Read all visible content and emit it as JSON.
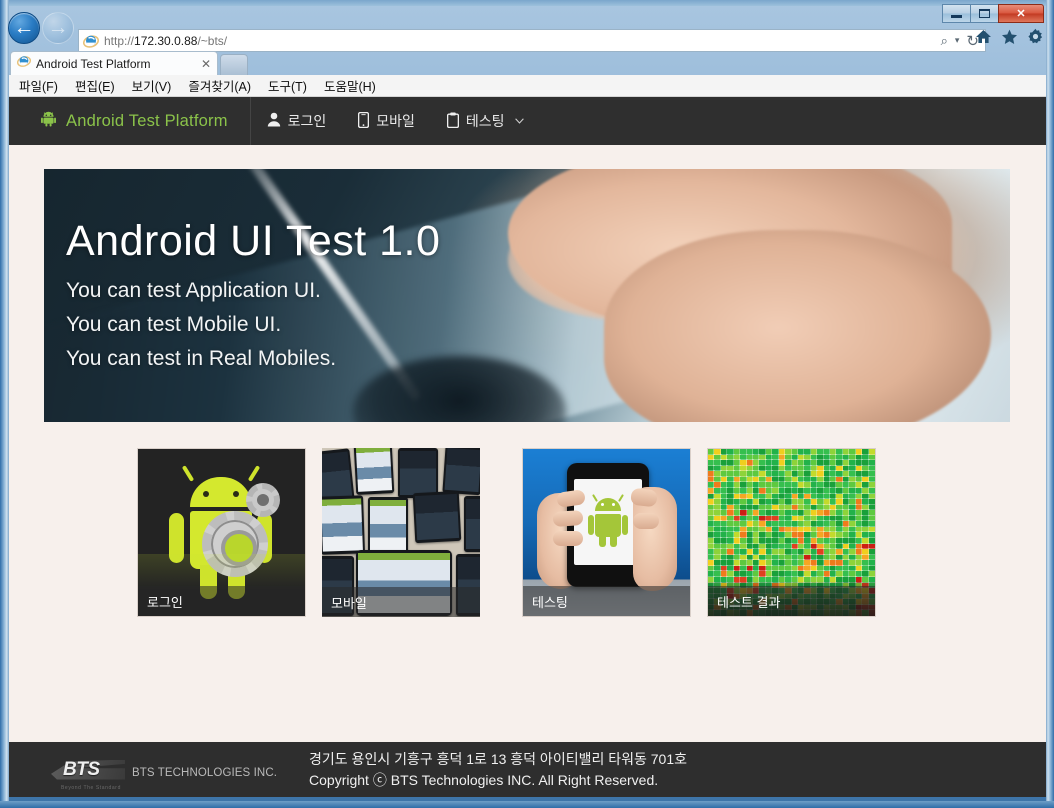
{
  "browser": {
    "window_controls": {
      "minimize": "minimize-button",
      "maximize": "maximize-button",
      "close": "✕"
    },
    "back_arrow": "←",
    "forward_arrow": "→",
    "address": {
      "scheme": "http://",
      "host": "172.30.0.88",
      "path": "/~bts/",
      "full": "http://172.30.0.88/~bts/"
    },
    "address_tools": {
      "search": "⌕",
      "dropdown": "▾",
      "refresh": "↻"
    },
    "toolbar_icons": {
      "home": "⌂",
      "favorites": "★",
      "tools": "⚙"
    },
    "tab": {
      "title": "Android Test Platform",
      "close": "✕"
    },
    "menu": [
      "파일(F)",
      "편집(E)",
      "보기(V)",
      "즐겨찾기(A)",
      "도구(T)",
      "도움말(H)"
    ]
  },
  "site": {
    "brand": {
      "label": "Android Test Platform",
      "icon": "android-robot-icon",
      "color": "#8bc34a"
    },
    "nav": [
      {
        "label": "로그인",
        "icon": "user-icon",
        "caret": ""
      },
      {
        "label": "모바일",
        "icon": "mobile-icon",
        "caret": ""
      },
      {
        "label": "테스팅",
        "icon": "clipboard-icon",
        "caret": "⌵"
      }
    ],
    "hero": {
      "heading": "Android UI Test 1.0",
      "lines": [
        "You can test Application UI.",
        "You can test Mobile UI.",
        "You can test in Real Mobiles."
      ]
    },
    "cards": [
      {
        "label": "로그인",
        "image": "android-robot-gears-thumbnail"
      },
      {
        "label": "모바일",
        "image": "many-mobile-phones-thumbnail"
      },
      {
        "label": "테스팅",
        "image": "hand-holding-phone-thumbnail"
      },
      {
        "label": "테스트 결과",
        "image": "test-results-heatmap-thumbnail"
      }
    ],
    "footer": {
      "logo_text": "BTS",
      "logo_subtitle": "BTS TECHNOLOGIES INC.",
      "logo_tagline": "Beyond The Standard",
      "address": "경기도 용인시 기흥구 흥덕 1로 13 흥덕 아이티밸리 타워동 701호",
      "copyright": "Copyright ⓒ BTS Technologies INC. All Right Reserved."
    }
  }
}
